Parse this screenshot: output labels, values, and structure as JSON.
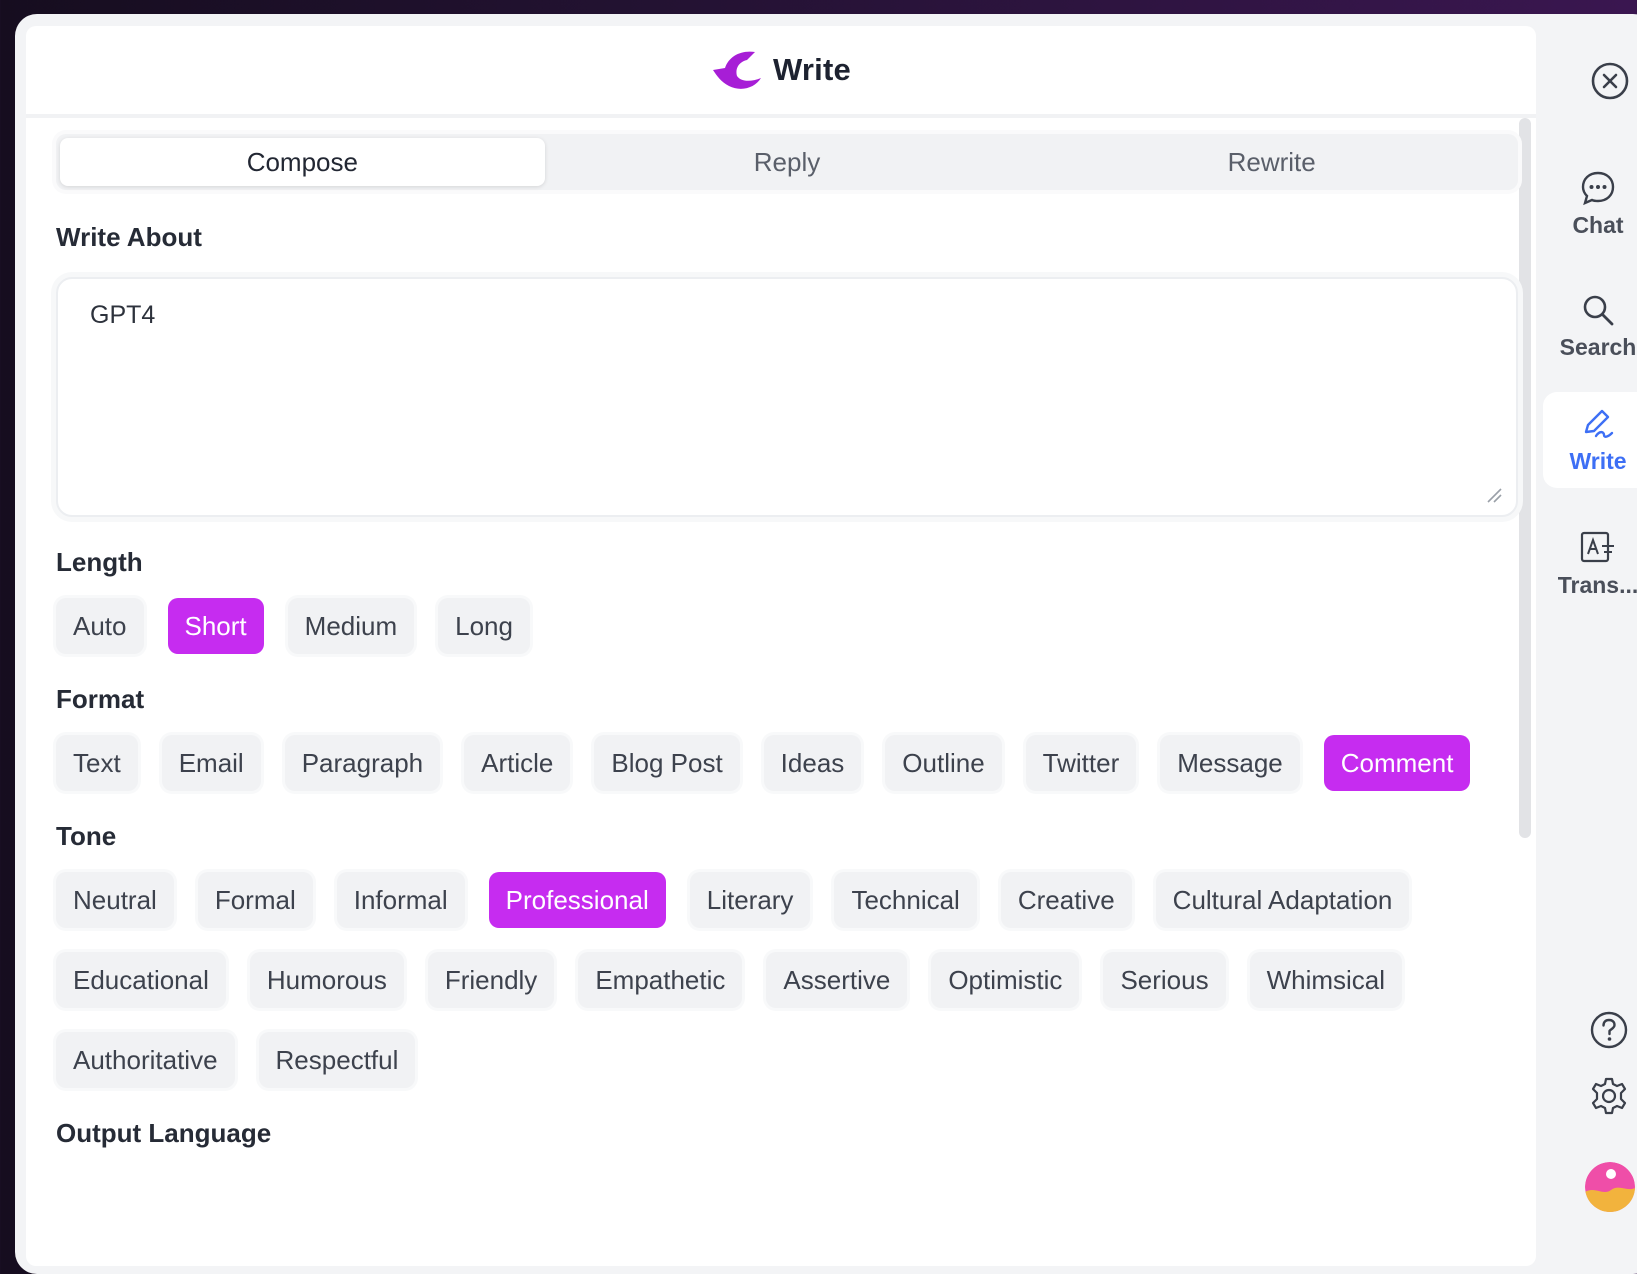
{
  "header": {
    "title": "Write"
  },
  "tabs": [
    {
      "label": "Compose",
      "active": true
    },
    {
      "label": "Reply",
      "active": false
    },
    {
      "label": "Rewrite",
      "active": false
    }
  ],
  "write_about": {
    "label": "Write About",
    "value": "GPT4"
  },
  "length": {
    "label": "Length",
    "options": [
      "Auto",
      "Short",
      "Medium",
      "Long"
    ],
    "selected": "Short"
  },
  "format": {
    "label": "Format",
    "options": [
      "Text",
      "Email",
      "Paragraph",
      "Article",
      "Blog Post",
      "Ideas",
      "Outline",
      "Twitter",
      "Message",
      "Comment"
    ],
    "selected": "Comment"
  },
  "tone": {
    "label": "Tone",
    "options": [
      "Neutral",
      "Formal",
      "Informal",
      "Professional",
      "Literary",
      "Technical",
      "Creative",
      "Cultural Adaptation",
      "Educational",
      "Humorous",
      "Friendly",
      "Empathetic",
      "Assertive",
      "Optimistic",
      "Serious",
      "Whimsical",
      "Authoritative",
      "Respectful"
    ],
    "selected": "Professional"
  },
  "output_language": {
    "label": "Output Language"
  },
  "sidebar": {
    "items": [
      {
        "label": "Chat",
        "icon": "chat-icon"
      },
      {
        "label": "Search",
        "icon": "search-icon"
      },
      {
        "label": "Write",
        "icon": "write-icon",
        "active": true
      },
      {
        "label": "Trans...",
        "icon": "translate-icon"
      }
    ],
    "bottom_icons": [
      "help-icon",
      "settings-icon",
      "avatar"
    ]
  },
  "colors": {
    "accent": "#c62cf0",
    "sidebar_active": "#3d6ff5",
    "logo": "#a71ed6"
  }
}
